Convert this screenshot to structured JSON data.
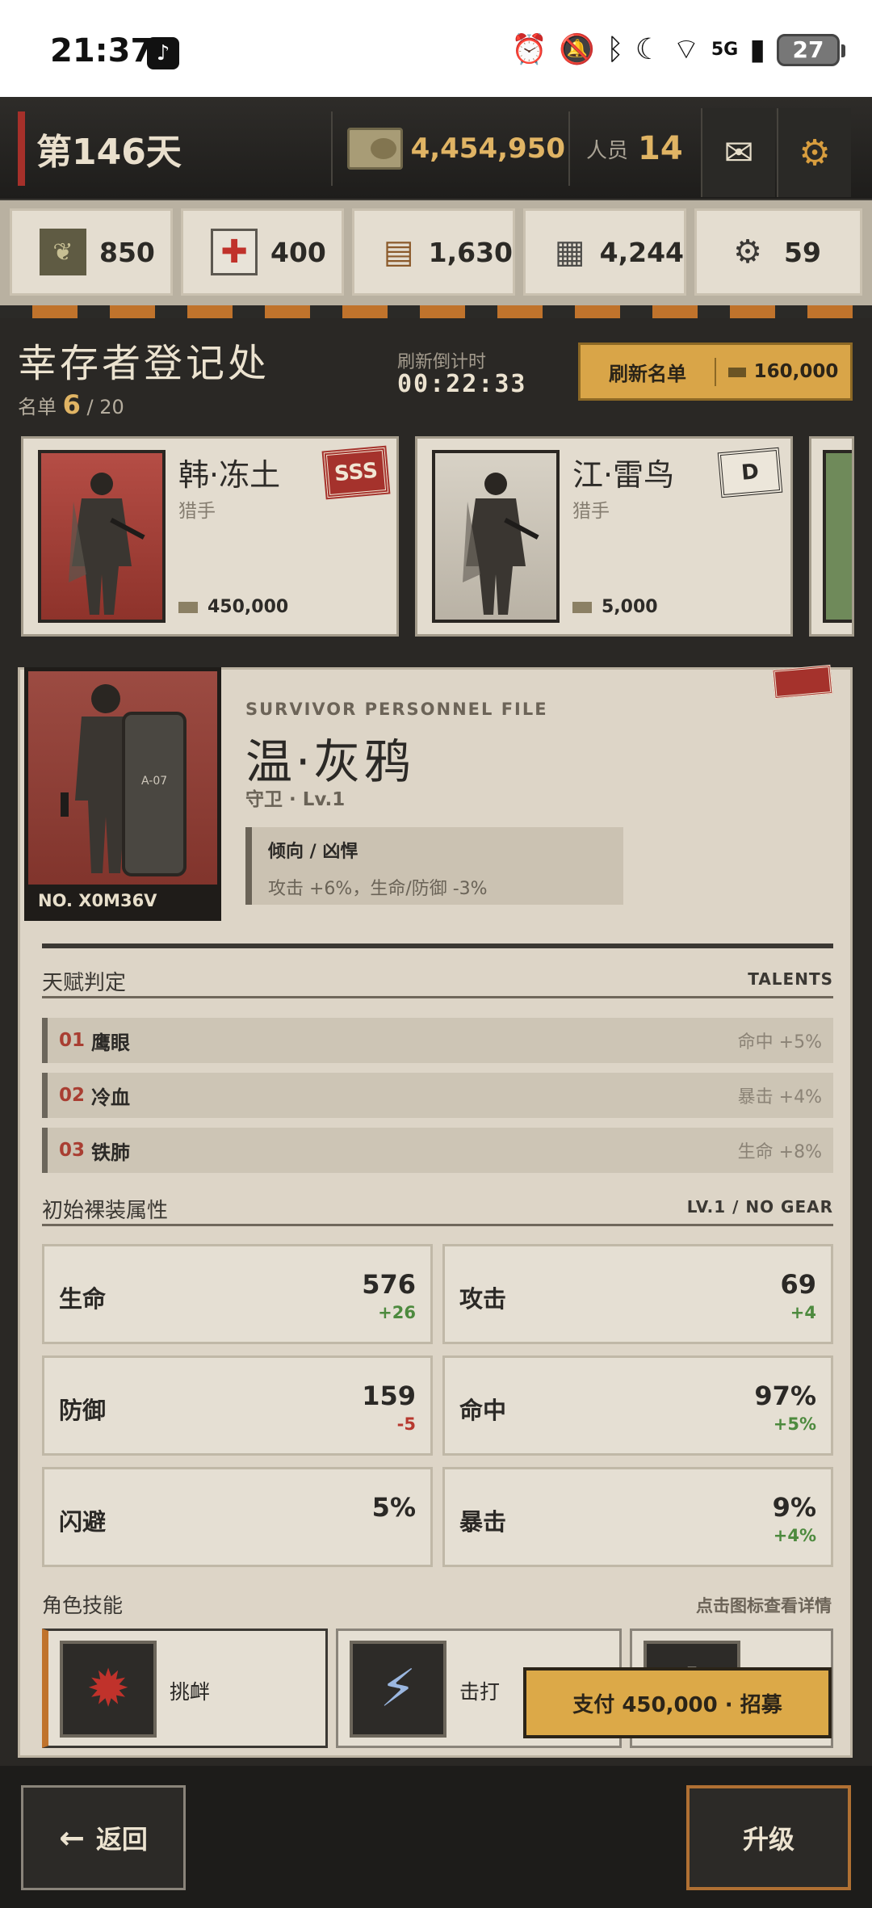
{
  "status_bar": {
    "time": "21:37",
    "battery": "27",
    "network": "5G"
  },
  "header": {
    "day": "第146天",
    "money": "4,454,950",
    "staff_label": "人员",
    "staff_count": "14"
  },
  "resources": [
    {
      "icon": "grain-can-icon",
      "value": "850"
    },
    {
      "icon": "medkit-icon",
      "value": "400"
    },
    {
      "icon": "wood-icon",
      "value": "1,630"
    },
    {
      "icon": "steel-icon",
      "value": "4,244"
    },
    {
      "icon": "gear-chip-icon",
      "value": "59"
    }
  ],
  "registry": {
    "title": "幸存者登记处",
    "roster_label": "名单",
    "roster_count": "6",
    "roster_max": "/ 20",
    "countdown_label": "刷新倒计时",
    "countdown": "00:22:33",
    "refresh_label": "刷新名单",
    "refresh_cost": "160,000"
  },
  "cards": [
    {
      "name": "韩·冻土",
      "role": "猎手",
      "price": "450,000",
      "grade": "SSS"
    },
    {
      "name": "江·雷鸟",
      "role": "猎手",
      "price": "5,000",
      "grade": "D"
    }
  ],
  "detail": {
    "file_label": "SURVIVOR PERSONNEL FILE",
    "name": "温·灰鸦",
    "class_level": "守卫 · Lv.1",
    "serial": "NO. X0M36V",
    "trait_title": "倾向 /   凶悍",
    "trait_desc": "攻击 +6%，生命/防御 -3%",
    "talents_label": "天赋判定",
    "talents_label_en": "TALENTS",
    "talents": [
      {
        "num": "01",
        "name": "鹰眼",
        "effect": "命中 +5%"
      },
      {
        "num": "02",
        "name": "冷血",
        "effect": "暴击 +4%"
      },
      {
        "num": "03",
        "name": "铁肺",
        "effect": "生命 +8%"
      }
    ],
    "stats_label": "初始裸装属性",
    "stats_label_en": "LV.1 / NO GEAR",
    "stats": [
      {
        "label": "生命",
        "value": "576",
        "delta": "+26"
      },
      {
        "label": "攻击",
        "value": "69",
        "delta": "+4"
      },
      {
        "label": "防御",
        "value": "159",
        "delta": "-5"
      },
      {
        "label": "命中",
        "value": "97%",
        "delta": "+5%"
      },
      {
        "label": "闪避",
        "value": "5%",
        "delta": ""
      },
      {
        "label": "暴击",
        "value": "9%",
        "delta": "+4%"
      }
    ],
    "skills_label": "角色技能",
    "skills_hint": "点击图标查看详情",
    "skills": [
      {
        "name": "挑衅",
        "icon": "taunt-icon"
      },
      {
        "name": "击打",
        "icon": "strike-icon"
      }
    ],
    "pay_label": "支付 450,000 · 招募"
  },
  "footer": {
    "back_label": "返回",
    "upgrade_label": "升级"
  }
}
